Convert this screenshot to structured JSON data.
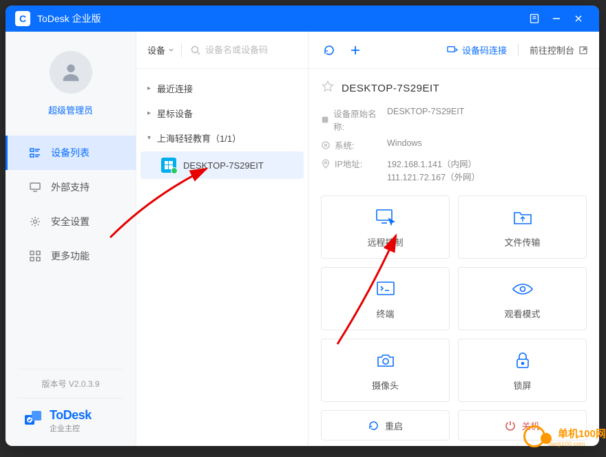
{
  "titlebar": {
    "title": "ToDesk 企业版"
  },
  "sidebar": {
    "username": "超级管理员",
    "items": [
      {
        "label": "设备列表"
      },
      {
        "label": "外部支持"
      },
      {
        "label": "安全设置"
      },
      {
        "label": "更多功能"
      }
    ],
    "version": "版本号 V2.0.3.9",
    "brand_name": "ToDesk",
    "brand_sub": "企业主控"
  },
  "mid": {
    "selector": "设备",
    "search_placeholder": "设备名或设备码",
    "tree": [
      {
        "label": "最近连接"
      },
      {
        "label": "星标设备"
      },
      {
        "label": "上海轻轻教育（1/1）"
      }
    ],
    "device_name": "DESKTOP-7S29EIT"
  },
  "right": {
    "link_connect": "设备码连接",
    "link_console": "前往控制台",
    "title": "DESKTOP-7S29EIT",
    "info": {
      "orig_label": "设备原始名称:",
      "orig_val": "DESKTOP-7S29EIT",
      "sys_label": "系统:",
      "sys_val": "Windows",
      "ip_label": "IP地址:",
      "ip_line1": "192.168.1.141（内网）",
      "ip_line2": "111.121.72.167（外网）"
    },
    "cards": {
      "remote": "远程控制",
      "file": "文件传输",
      "terminal": "终端",
      "watch": "观看模式",
      "camera": "摄像头",
      "lock": "锁屏"
    },
    "footer": {
      "restart": "重启",
      "shutdown": "关机"
    }
  },
  "watermark": {
    "name": "单机100网",
    "url": "danji100.com"
  }
}
